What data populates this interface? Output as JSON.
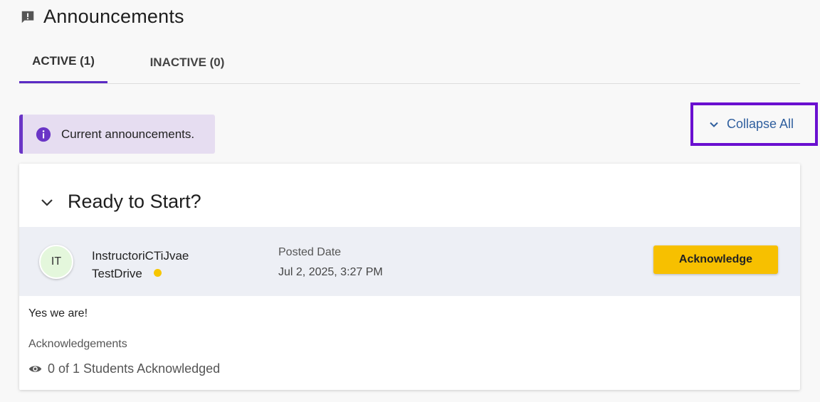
{
  "header": {
    "title": "Announcements",
    "icon": "announcement-icon"
  },
  "tabs": [
    {
      "label": "ACTIVE (1)",
      "active": true
    },
    {
      "label": "INACTIVE (0)",
      "active": false
    }
  ],
  "info_banner": {
    "text": "Current announcements.",
    "icon": "info-icon"
  },
  "collapse_all": {
    "label": "Collapse All",
    "icon": "chevron-down-icon"
  },
  "announcement": {
    "title": "Ready to Start?",
    "author": {
      "initials": "IT",
      "first_line": "InstructoriCTiJvae",
      "second_line": "TestDrive",
      "status_color": "#f7c600"
    },
    "posted_label": "Posted Date",
    "posted_date": "Jul 2, 2025, 3:27 PM",
    "acknowledge_label": "Acknowledge",
    "body": "Yes we are!",
    "acknowledgements_label": "Acknowledgements",
    "acknowledgements_count": "0 of 1 Students Acknowledged"
  },
  "colors": {
    "accent": "#5b2bc4",
    "button": "#f7c000",
    "link": "#2f5f9e"
  }
}
